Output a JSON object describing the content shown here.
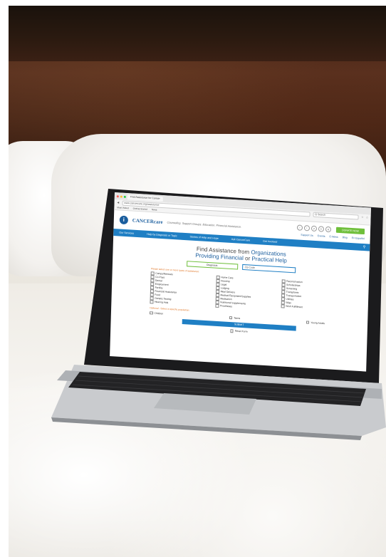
{
  "browser": {
    "tab_title": "Find Assistance for Cancer",
    "tab2": "",
    "url": "www.cancercare.org/assistance",
    "search_placeholder": "Q Search",
    "bookmarks": [
      "Most Visited",
      "Getting Started",
      "News"
    ]
  },
  "site": {
    "logo_letter": "i",
    "logo_text": "CANCERcare",
    "tagline": "Counseling. Support Groups. Education. Financial Assistance.",
    "donate_label": "DONATE NOW",
    "social_icons": [
      "f",
      "t",
      "yt",
      "in",
      "ig"
    ],
    "util_links": [
      "Support Us",
      "Events",
      "E-News",
      "Blog",
      "En Español"
    ]
  },
  "nav": {
    "items": [
      "Our Services",
      "Help by Diagnosis or Topic",
      "Stories of Help and Hope",
      "Ask CancerCare",
      "Get Involved"
    ]
  },
  "main": {
    "heading_line1_a": "Find Assistance",
    "heading_line1_b": "from",
    "heading_line1_c": "Organizations",
    "heading_line2_a": "Providing Financial",
    "heading_line2_b": "or",
    "heading_line2_c": "Practical Help",
    "diagnosis_select": "Diagnosis",
    "zip_placeholder": "Zip Code",
    "types_note": "Please select one or more types of assistance:",
    "types": [
      "Camps/Retreats",
      "Home Care",
      "Reconstruction",
      "Co-Pays",
      "Housing",
      "Scholarships",
      "Dental",
      "Legal",
      "Screening",
      "Employment",
      "Lodging",
      "Transplants",
      "Fertility",
      "Meal Delivery",
      "Transportation",
      "Financial Assistance",
      "Medical Equipment/Supplies",
      "Utilities",
      "Food",
      "Medication",
      "Wigs",
      "Genetic Testing",
      "Nutritional Supplements",
      "Wish Fulfillment",
      "Hearing Aids",
      "Prostheses",
      ""
    ],
    "age_note": "Optional - Select a specific population:",
    "ages": [
      "Children",
      "Teens",
      "Young Adults"
    ],
    "submit_label": "SUBMIT",
    "reset_label": "Reset Form"
  }
}
